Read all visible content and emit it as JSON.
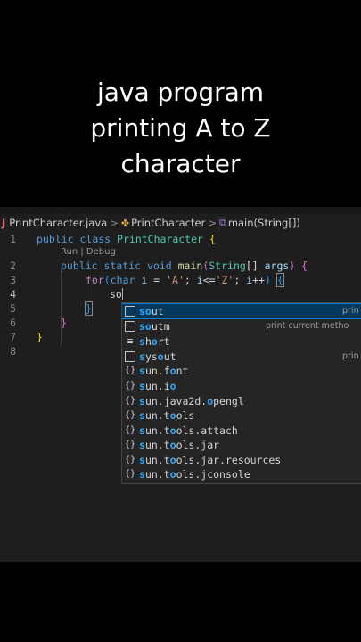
{
  "caption": {
    "line1": "java program",
    "line2": "printing A to Z",
    "line3": "character"
  },
  "breadcrumb": {
    "file_icon": "J",
    "file": "PrintCharacter.java",
    "class_icon": "✤",
    "class": "PrintCharacter",
    "method_icon": "⧉",
    "method": "main(String[])",
    "separator": ">"
  },
  "line_numbers": [
    "1",
    "2",
    "3",
    "4",
    "5",
    "6",
    "7",
    "8"
  ],
  "codelens": "Run | Debug",
  "code": {
    "l1": {
      "kw1": "public",
      "kw2": "class",
      "name": "PrintCharacter",
      "brace": "{"
    },
    "l2": {
      "kw1": "public",
      "kw2": "static",
      "kw3": "void",
      "fn": "main",
      "p_open": "(",
      "type": "String",
      "arr": "[]",
      "param": "args",
      "p_close": ")",
      "brace": "{"
    },
    "l3": {
      "kw": "for",
      "p_open": "(",
      "type": "char",
      "var": "i",
      "eq": "=",
      "lit1": "'A'",
      "semi1": ";",
      "cond_var": "i",
      "op": "<=",
      "lit2": "'Z'",
      "semi2": ";",
      "inc_var": "i",
      "inc": "++",
      "p_close": ")",
      "brace": "{"
    },
    "l4": {
      "typed": "so"
    },
    "l5": {
      "brace": "}"
    },
    "l6": {
      "brace": "}"
    },
    "l7": {
      "brace": "}"
    }
  },
  "suggestions": [
    {
      "icon": "box",
      "match": "so",
      "rest": "ut",
      "detail": "prin",
      "detail_pos": "far",
      "selected": true
    },
    {
      "icon": "box",
      "match": "so",
      "rest": "utm",
      "detail": "print current metho",
      "detail_pos": "near",
      "selected": false
    },
    {
      "icon": "text",
      "match": "s",
      "rest": "h",
      "after": "o",
      "tail": "rt",
      "detail": "",
      "selected": false
    },
    {
      "icon": "box",
      "match": "s",
      "rest": "ys",
      "after": "o",
      "tail": "ut",
      "detail": "prin",
      "detail_pos": "far",
      "selected": false
    },
    {
      "icon": "braces",
      "match": "s",
      "rest": "un.f",
      "after": "o",
      "tail": "nt",
      "detail": "",
      "selected": false
    },
    {
      "icon": "braces",
      "match": "s",
      "rest": "un.i",
      "after": "o",
      "tail": "",
      "detail": "",
      "selected": false
    },
    {
      "icon": "braces",
      "match": "s",
      "rest": "un.java2d.",
      "after": "o",
      "tail": "pengl",
      "detail": "",
      "selected": false
    },
    {
      "icon": "braces",
      "match": "s",
      "rest": "un.t",
      "after": "o",
      "tail": "ols",
      "detail": "",
      "selected": false
    },
    {
      "icon": "braces",
      "match": "s",
      "rest": "un.t",
      "after": "o",
      "tail": "ols.attach",
      "detail": "",
      "selected": false
    },
    {
      "icon": "braces",
      "match": "s",
      "rest": "un.t",
      "after": "o",
      "tail": "ols.jar",
      "detail": "",
      "selected": false
    },
    {
      "icon": "braces",
      "match": "s",
      "rest": "un.t",
      "after": "o",
      "tail": "ols.jar.resources",
      "detail": "",
      "selected": false
    },
    {
      "icon": "braces",
      "match": "s",
      "rest": "un.t",
      "after": "o",
      "tail": "ols.jconsole",
      "detail": "",
      "selected": false
    }
  ],
  "icons": {
    "box": "",
    "text": "≡",
    "braces": "{}"
  },
  "colors": {
    "background": "#000000",
    "editor": "#1e1e1e",
    "selection": "#04395e",
    "match": "#2aaaff",
    "keyword": "#569cd6",
    "type": "#4ec9b0"
  }
}
